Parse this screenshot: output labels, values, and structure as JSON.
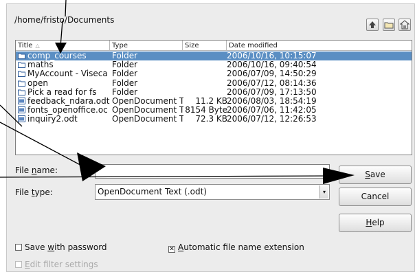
{
  "path": "/home/fristo/Documents",
  "toolbar": {
    "up_icon": "up-level-icon",
    "new_folder_icon": "new-folder-icon",
    "default_dir_icon": "default-directory-icon"
  },
  "list": {
    "columns": {
      "title": "Title",
      "type": "Type",
      "size": "Size",
      "date": "Date modified"
    },
    "rows": [
      {
        "title": "comp_courses",
        "type": "Folder",
        "size": "",
        "date": "2006/10/16, 10:15:07",
        "icon": "folder"
      },
      {
        "title": "maths",
        "type": "Folder",
        "size": "",
        "date": "2006/10/16, 09:40:54",
        "icon": "folder"
      },
      {
        "title": "MyAccount - Viseca",
        "type": "Folder",
        "size": "",
        "date": "2006/07/09, 14:50:29",
        "icon": "folder"
      },
      {
        "title": "open",
        "type": "Folder",
        "size": "",
        "date": "2006/07/12, 08:14:36",
        "icon": "folder"
      },
      {
        "title": "Pick a read for fs",
        "type": "Folder",
        "size": "",
        "date": "2006/07/09, 17:13:50",
        "icon": "folder"
      },
      {
        "title": "feedback_ndara.odt",
        "type": "OpenDocument T",
        "size": "11.2 KB",
        "date": "2006/08/03, 18:54:19",
        "icon": "document"
      },
      {
        "title": "fonts_openoffice.oc",
        "type": "OpenDocument T",
        "size": "8154 Byte",
        "date": "2006/07/06, 11:42:05",
        "icon": "document"
      },
      {
        "title": "inquiry2.odt",
        "type": "OpenDocument T",
        "size": "72.3 KB",
        "date": "2006/07/12, 12:26:53",
        "icon": "document"
      }
    ]
  },
  "file_name": {
    "label_pre": "File ",
    "label_key": "n",
    "label_post": "ame:",
    "value": ""
  },
  "file_type": {
    "label_pre": "File ",
    "label_key": "t",
    "label_post": "ype:",
    "value": "OpenDocument Text (.odt)"
  },
  "buttons": {
    "save_key": "S",
    "save_rest": "ave",
    "cancel": "Cancel",
    "help_key": "H",
    "help_rest": "elp"
  },
  "options": {
    "save_pw_pre": "Save ",
    "save_pw_key": "w",
    "save_pw_post": "ith password",
    "auto_ext_key": "A",
    "auto_ext_rest": "utomatic file name extension",
    "edit_filter_key": "E",
    "edit_filter_rest": "dit filter settings"
  },
  "colors": {
    "selection": "#5a8ec3",
    "dialog_bg": "#ececec"
  }
}
